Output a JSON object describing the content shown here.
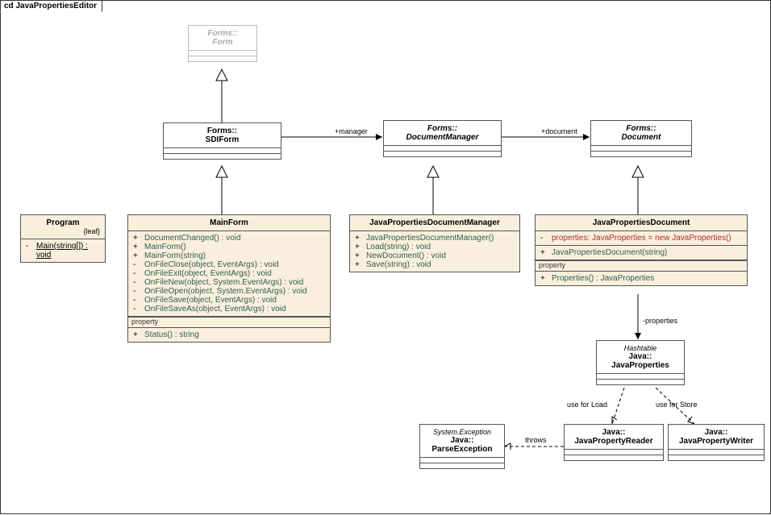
{
  "tab": {
    "prefix": "cd ",
    "title": "JavaPropertiesEditor"
  },
  "classes": {
    "formsForm": {
      "pkg": "Forms::",
      "name": "Form"
    },
    "sdiForm": {
      "pkg": "Forms::",
      "name": "SDIForm"
    },
    "docManager": {
      "pkg": "Forms::",
      "name": "DocumentManager"
    },
    "document": {
      "pkg": "Forms::",
      "name": "Document"
    },
    "program": {
      "name": "Program",
      "constraint": "{leaf}",
      "members": [
        {
          "vis": "-",
          "sig": "Main(string[]) : void",
          "under": true
        }
      ]
    },
    "mainForm": {
      "name": "MainForm",
      "members": [
        {
          "vis": "+",
          "sig": "DocumentChanged() : void"
        },
        {
          "vis": "+",
          "sig": "MainForm()"
        },
        {
          "vis": "+",
          "sig": "MainForm(string)"
        },
        {
          "vis": "-",
          "sig": "OnFileClose(object, EventArgs) : void"
        },
        {
          "vis": "-",
          "sig": "OnFileExit(object, EventArgs) : void"
        },
        {
          "vis": "-",
          "sig": "OnFileNew(object, System.EventArgs) : void"
        },
        {
          "vis": "-",
          "sig": "OnFileOpen(object, System.EventArgs) : void"
        },
        {
          "vis": "-",
          "sig": "OnFileSave(object, EventArgs) : void"
        },
        {
          "vis": "-",
          "sig": "OnFileSaveAs(object, EventArgs) : void"
        }
      ],
      "propLabel": "property",
      "props": [
        {
          "vis": "+",
          "sig": "Status() : string"
        }
      ]
    },
    "jpDocMan": {
      "name": "JavaPropertiesDocumentManager",
      "members": [
        {
          "vis": "+",
          "sig": "JavaPropertiesDocumentManager()"
        },
        {
          "vis": "+",
          "sig": "Load(string) : void"
        },
        {
          "vis": "+",
          "sig": "NewDocument() : void"
        },
        {
          "vis": "+",
          "sig": "Save(string) : void"
        }
      ]
    },
    "jpDoc": {
      "name": "JavaPropertiesDocument",
      "attrs": [
        {
          "vis": "-",
          "sig": "properties:  JavaProperties = new JavaProperties()",
          "red": true
        }
      ],
      "members": [
        {
          "vis": "+",
          "sig": "JavaPropertiesDocument(string)"
        }
      ],
      "propLabel": "property",
      "props": [
        {
          "vis": "+",
          "sig": "Properties() : JavaProperties"
        }
      ]
    },
    "javaProps": {
      "stereo": "Hashtable",
      "pkg": "Java::",
      "name": "JavaProperties"
    },
    "parseEx": {
      "stereo": "System.Exception",
      "pkg": "Java::",
      "name": "ParseException"
    },
    "jpReader": {
      "pkg": "Java::",
      "name": "JavaPropertyReader"
    },
    "jpWriter": {
      "pkg": "Java::",
      "name": "JavaPropertyWriter"
    }
  },
  "labels": {
    "manager": "+manager",
    "document": "+document",
    "properties": "-properties",
    "useLoad": "use for Load",
    "useStore": "use for Store",
    "throws": "throws"
  }
}
